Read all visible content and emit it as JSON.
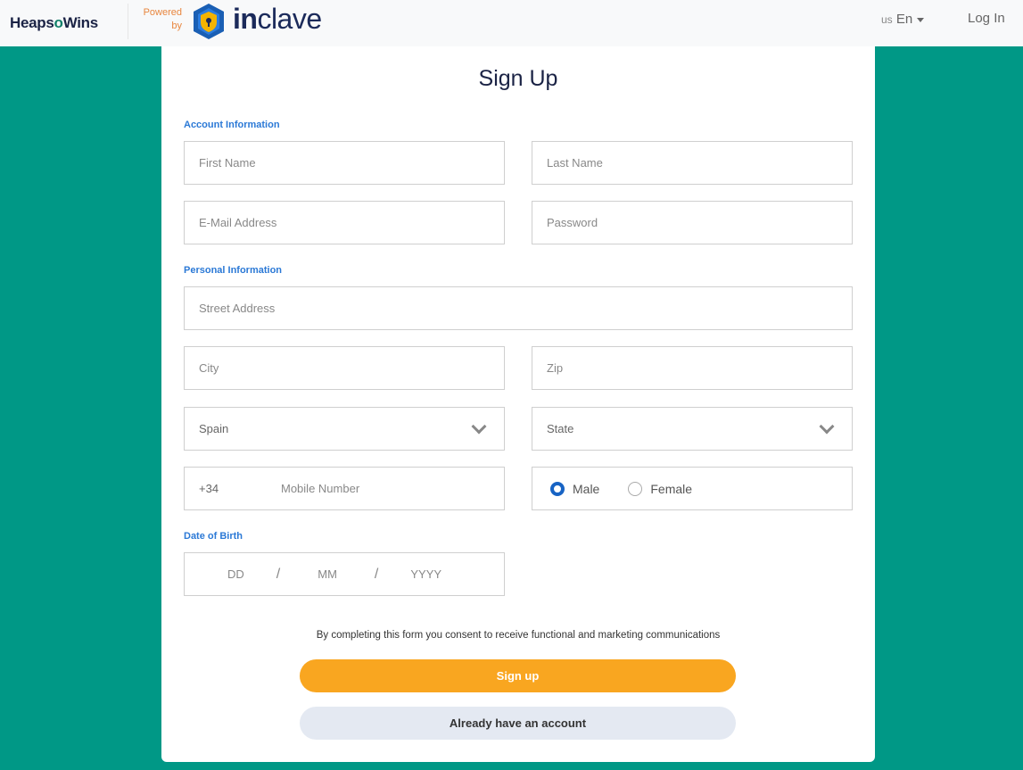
{
  "header": {
    "brand_left": "Heaps",
    "brand_o": "o",
    "brand_right": "Wins",
    "powered_by_line1": "Powered",
    "powered_by_line2": "by",
    "partner_brand_bold": "in",
    "partner_brand_rest": "clave",
    "language_country": "us",
    "language_label": "En",
    "login_label": "Log In"
  },
  "form": {
    "title": "Sign Up",
    "sections": {
      "account": "Account Information",
      "personal": "Personal Information",
      "dob": "Date of Birth"
    },
    "fields": {
      "first_name": {
        "placeholder": "First Name",
        "value": ""
      },
      "last_name": {
        "placeholder": "Last Name",
        "value": ""
      },
      "email": {
        "placeholder": "E-Mail Address",
        "value": ""
      },
      "password": {
        "placeholder": "Password",
        "value": ""
      },
      "street": {
        "placeholder": "Street Address",
        "value": ""
      },
      "city": {
        "placeholder": "City",
        "value": ""
      },
      "zip": {
        "placeholder": "Zip",
        "value": ""
      },
      "country": {
        "selected": "Spain"
      },
      "state": {
        "selected": "State"
      },
      "phone_prefix": "+34",
      "mobile": {
        "placeholder": "Mobile Number",
        "value": ""
      }
    },
    "gender": {
      "options": [
        "Male",
        "Female"
      ],
      "selected": "Male"
    },
    "dob": {
      "day_placeholder": "DD",
      "month_placeholder": "MM",
      "year_placeholder": "YYYY",
      "separator": "/"
    },
    "consent_text": "By completing this form you consent to receive functional and marketing communications",
    "submit_label": "Sign up",
    "secondary_label": "Already have an account"
  },
  "colors": {
    "background": "#009886",
    "primary_button": "#f9a620",
    "section_label": "#2b79d6",
    "radio_selected": "#1763c4"
  }
}
